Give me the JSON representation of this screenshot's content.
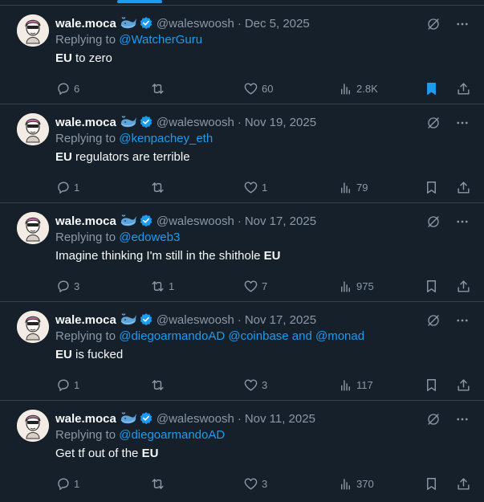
{
  "tweets": [
    {
      "name": "wale.moca",
      "handle": "@waleswoosh",
      "date": "Dec 5, 2025",
      "reply_prefix": "Replying to ",
      "reply_to": "@WatcherGuru",
      "text_parts": [
        {
          "t": "EU",
          "b": true
        },
        {
          "t": " to zero",
          "b": false
        }
      ],
      "replies": "6",
      "retweets": "",
      "likes": "60",
      "views": "2.8K",
      "bookmarked": true
    },
    {
      "name": "wale.moca",
      "handle": "@waleswoosh",
      "date": "Nov 19, 2025",
      "reply_prefix": "Replying to ",
      "reply_to": "@kenpachey_eth",
      "text_parts": [
        {
          "t": "EU",
          "b": true
        },
        {
          "t": " regulators are terrible",
          "b": false
        }
      ],
      "replies": "1",
      "retweets": "",
      "likes": "1",
      "views": "79",
      "bookmarked": false
    },
    {
      "name": "wale.moca",
      "handle": "@waleswoosh",
      "date": "Nov 17, 2025",
      "reply_prefix": "Replying to ",
      "reply_to": "@edoweb3",
      "text_parts": [
        {
          "t": "Imagine thinking I'm still in the shithole ",
          "b": false
        },
        {
          "t": "EU",
          "b": true
        }
      ],
      "replies": "3",
      "retweets": "1",
      "likes": "7",
      "views": "975",
      "bookmarked": false
    },
    {
      "name": "wale.moca",
      "handle": "@waleswoosh",
      "date": "Nov 17, 2025",
      "reply_prefix": "Replying to ",
      "reply_to": "@diegoarmandoAD @coinbase and @monad",
      "text_parts": [
        {
          "t": "EU",
          "b": true
        },
        {
          "t": " is fucked",
          "b": false
        }
      ],
      "replies": "1",
      "retweets": "",
      "likes": "3",
      "views": "117",
      "bookmarked": false
    },
    {
      "name": "wale.moca",
      "handle": "@waleswoosh",
      "date": "Nov 11, 2025",
      "reply_prefix": "Replying to ",
      "reply_to": "@diegoarmandoAD",
      "text_parts": [
        {
          "t": "Get tf out of the ",
          "b": false
        },
        {
          "t": "EU",
          "b": true
        }
      ],
      "replies": "1",
      "retweets": "",
      "likes": "3",
      "views": "370",
      "bookmarked": false
    }
  ],
  "colors": {
    "background": "#15202b",
    "accent": "#1d9bf0",
    "muted": "#8b98a5",
    "text": "#f7f9f9",
    "divider": "#38444d"
  },
  "icons": {
    "reply": "reply-icon",
    "retweet": "retweet-icon",
    "like": "heart-icon",
    "views": "views-icon",
    "bookmark": "bookmark-icon",
    "share": "share-icon",
    "grok": "grok-icon",
    "more": "more-icon"
  }
}
